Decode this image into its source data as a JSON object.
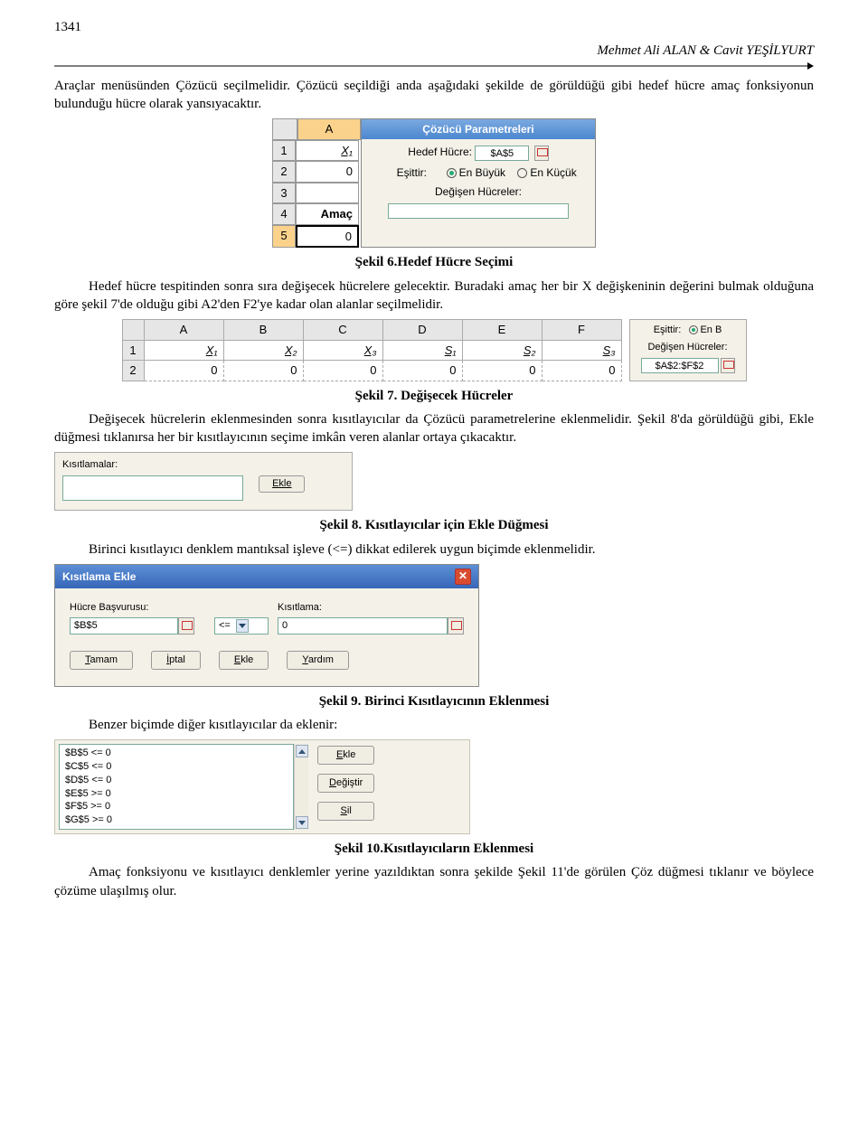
{
  "page_number": "1341",
  "header_author": "Mehmet Ali ALAN & Cavit YEŞİLYURT",
  "para1": "Araçlar menüsünden Çözücü seçilmelidir. Çözücü seçildiği anda aşağıdaki şekilde de görüldüğü gibi hedef hücre amaç fonksiyonun bulunduğu hücre olarak yansıyacaktır.",
  "fig6": {
    "col_header": "A",
    "rows": [
      "1",
      "2",
      "3",
      "4",
      "5"
    ],
    "valsA": [
      "X₁",
      "0",
      "",
      "Amaç",
      "0"
    ],
    "dlg_title": "Çözücü Parametreleri",
    "hedef_label": "Hedef Hücre:",
    "hedef_val": "$A$5",
    "esittir_label": "Eşittir:",
    "opt_big": "En Büyük",
    "opt_small": "En Küçük",
    "degisen_label": "Değişen Hücreler:"
  },
  "caption6": "Şekil 6.Hedef Hücre Seçimi",
  "para2": "Hedef hücre tespitinden sonra sıra değişecek hücrelere gelecektir. Buradaki amaç her bir X değişkeninin değerini bulmak olduğuna göre şekil 7'de olduğu gibi A2'den F2'ye kadar olan alanlar seçilmelidir.",
  "fig7": {
    "cols": [
      "A",
      "B",
      "C",
      "D",
      "E",
      "F"
    ],
    "row1": [
      "X₁",
      "X₂",
      "X₃",
      "S₁",
      "S₂",
      "S₃"
    ],
    "row2": [
      "0",
      "0",
      "0",
      "0",
      "0",
      "0"
    ],
    "side_esittir": "Eşittir:",
    "side_enb": "En B",
    "side_degisen": "Değişen Hücreler:",
    "side_val": "$A$2:$F$2"
  },
  "caption7": "Şekil 7. Değişecek Hücreler",
  "para3": "Değişecek hücrelerin eklenmesinden sonra kısıtlayıcılar da Çözücü parametrelerine eklenmelidir. Şekil 8'da görüldüğü gibi, Ekle düğmesi tıklanırsa her bir kısıtlayıcının seçime imkân veren alanlar ortaya çıkacaktır.",
  "fig8": {
    "label": "Kısıtlamalar:",
    "btn_ekle": "Ekle"
  },
  "caption8": "Şekil 8. Kısıtlayıcılar için Ekle Düğmesi",
  "para4": "Birinci kısıtlayıcı denklem mantıksal işleve (<=) dikkat edilerek uygun biçimde eklenmelidir.",
  "fig9": {
    "title": "Kısıtlama Ekle",
    "lab1": "Hücre Başvurusu:",
    "val1": "$B$5",
    "op": "<=",
    "lab2": "Kısıtlama:",
    "val2": "0",
    "btn_tamam": "Tamam",
    "btn_iptal": "İptal",
    "btn_ekle": "Ekle",
    "btn_yardim": "Yardım"
  },
  "caption9": "Şekil 9. Birinci Kısıtlayıcının Eklenmesi",
  "para5": "Benzer biçimde diğer kısıtlayıcılar da eklenir:",
  "fig10": {
    "items": [
      "$B$5 <= 0",
      "$C$5 <= 0",
      "$D$5 <= 0",
      "$E$5 >= 0",
      "$F$5 >= 0",
      "$G$5 >= 0"
    ],
    "btn_ekle": "Ekle",
    "btn_degistir": "Değiştir",
    "btn_sil": "Sil"
  },
  "caption10": "Şekil 10.Kısıtlayıcıların Eklenmesi",
  "para6": "Amaç fonksiyonu ve kısıtlayıcı denklemler yerine yazıldıktan sonra şekilde Şekil 11'de görülen Çöz düğmesi tıklanır ve böylece çözüme ulaşılmış olur."
}
